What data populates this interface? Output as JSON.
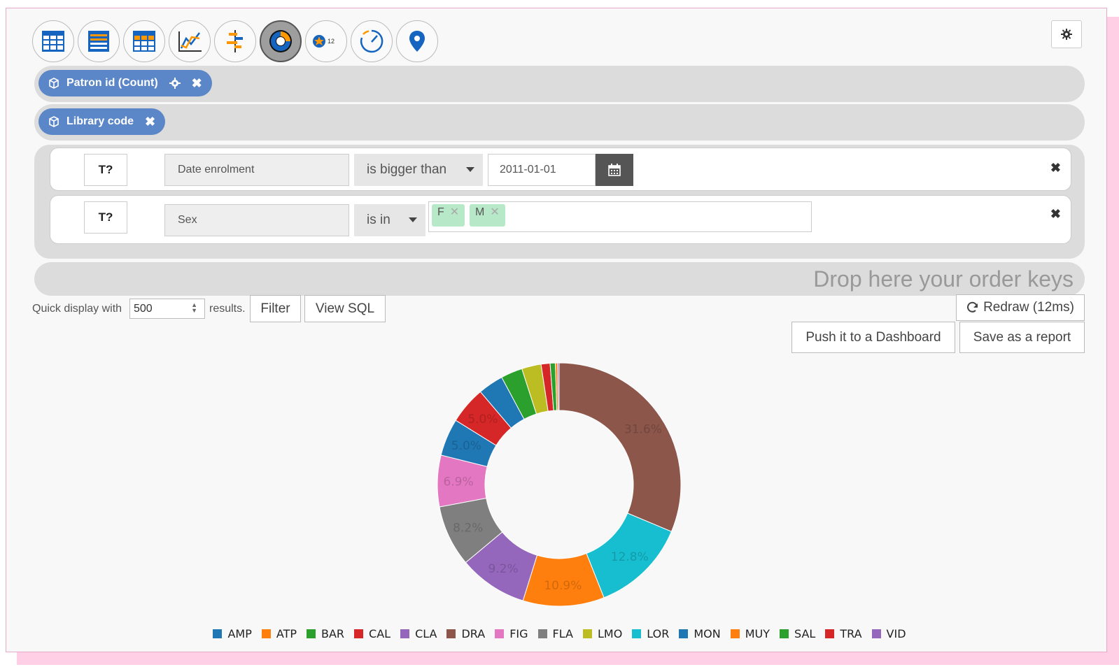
{
  "toolbar": {
    "chart_types": [
      {
        "name": "table-icon",
        "active": false
      },
      {
        "name": "list-table-icon",
        "active": false
      },
      {
        "name": "pivot-table-icon",
        "active": false
      },
      {
        "name": "line-chart-icon",
        "active": false
      },
      {
        "name": "bar-chart-icon",
        "active": false
      },
      {
        "name": "donut-chart-icon",
        "active": true
      },
      {
        "name": "counter-icon",
        "active": false
      },
      {
        "name": "gauge-icon",
        "active": false
      },
      {
        "name": "map-pin-icon",
        "active": false
      }
    ],
    "counter_badge": "12"
  },
  "measures": {
    "label": "Patron id (Count)"
  },
  "dimensions": {
    "label": "Library code"
  },
  "filters": [
    {
      "field": "Date enrolment",
      "operator": "is bigger than",
      "value": "2011-01-01"
    },
    {
      "field": "Sex",
      "operator": "is in",
      "tags": [
        "F",
        "M"
      ]
    }
  ],
  "filter_button_label": "T?",
  "order_zone": {
    "placeholder": "Drop here your order keys"
  },
  "controls": {
    "quick_display_prefix": "Quick display with",
    "quick_display_value": "500",
    "quick_display_suffix": "results.",
    "filter_label": "Filter",
    "view_sql_label": "View SQL",
    "redraw_label": "Redraw (12ms)",
    "push_dashboard_label": "Push it to a Dashboard",
    "save_report_label": "Save as a report"
  },
  "chart_data": {
    "type": "pie",
    "donut": true,
    "categories": [
      "DRA",
      "LOR",
      "MUY",
      "VID",
      "FLA",
      "FIG",
      "AMP",
      "CAL",
      "MON",
      "SAL",
      "LMO",
      "TRA",
      "BAR",
      "ATP",
      "CLA"
    ],
    "values": [
      31.6,
      12.8,
      10.9,
      9.2,
      8.2,
      6.9,
      5.0,
      5.0,
      3.4,
      2.9,
      2.6,
      1.2,
      0.7,
      0.3,
      0.2
    ],
    "value_labels": [
      "31.6%",
      "12.8%",
      "10.9%",
      "9.2%",
      "8.2%",
      "6.9%",
      "5.0%",
      "5.0%",
      "",
      "",
      "",
      "",
      "",
      "",
      ""
    ],
    "colors": [
      "#8c564b",
      "#17becf",
      "#ff7f0e",
      "#9467bd",
      "#7f7f7f",
      "#e377c2",
      "#1f77b4",
      "#d62728",
      "#1f77b4",
      "#2ca02c",
      "#bcbd22",
      "#d62728",
      "#2ca02c",
      "#ff7f0e",
      "#9467bd"
    ],
    "legend": [
      {
        "label": "AMP",
        "color": "#1f77b4"
      },
      {
        "label": "ATP",
        "color": "#ff7f0e"
      },
      {
        "label": "BAR",
        "color": "#2ca02c"
      },
      {
        "label": "CAL",
        "color": "#d62728"
      },
      {
        "label": "CLA",
        "color": "#9467bd"
      },
      {
        "label": "DRA",
        "color": "#8c564b"
      },
      {
        "label": "FIG",
        "color": "#e377c2"
      },
      {
        "label": "FLA",
        "color": "#7f7f7f"
      },
      {
        "label": "LMO",
        "color": "#bcbd22"
      },
      {
        "label": "LOR",
        "color": "#17becf"
      },
      {
        "label": "MON",
        "color": "#1f77b4"
      },
      {
        "label": "MUY",
        "color": "#ff7f0e"
      },
      {
        "label": "SAL",
        "color": "#2ca02c"
      },
      {
        "label": "TRA",
        "color": "#d62728"
      },
      {
        "label": "VID",
        "color": "#9467bd"
      }
    ],
    "legend_position": "bottom"
  }
}
